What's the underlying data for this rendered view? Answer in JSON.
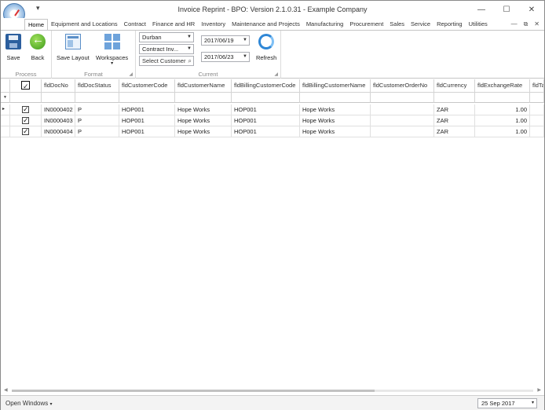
{
  "window": {
    "title": "Invoice Reprint - BPO: Version 2.1.0.31 - Example Company",
    "qat_symbol": "▾",
    "controls": {
      "minimize": "—",
      "maximize": "☐",
      "close": "✕"
    }
  },
  "ribbon_tabs": [
    "Home",
    "Equipment and Locations",
    "Contract",
    "Finance and HR",
    "Inventory",
    "Maintenance and Projects",
    "Manufacturing",
    "Procurement",
    "Sales",
    "Service",
    "Reporting",
    "Utilities"
  ],
  "tab_controls": {
    "minimize": "—",
    "restore": "⧉",
    "close": "✕"
  },
  "ribbon": {
    "process": {
      "label": "Process",
      "save": "Save",
      "back": "Back"
    },
    "format": {
      "label": "Format",
      "save_layout": "Save Layout",
      "workspaces": "Workspaces",
      "workspaces_arrow": "▾"
    },
    "current": {
      "label": "Current",
      "branch": "Durban",
      "doc_type": "Contract Inv...",
      "customer_placeholder": "Select Customer",
      "date_from": "2017/06/19",
      "date_to": "2017/06/23",
      "refresh": "Refresh"
    }
  },
  "grid": {
    "columns": [
      "fldDocNo",
      "fldDocStatus",
      "fldCustomerCode",
      "fldCustomerName",
      "fldBillingCustomerCode",
      "fldBillingCustomerName",
      "fldCustomerOrderNo",
      "fldCurrency",
      "fldExchangeRate",
      "fldTa"
    ],
    "filter_row_symbol": "▼",
    "current_row_symbol": "▸",
    "rows": [
      {
        "selected": true,
        "doc_no": "IN0000402",
        "status": "P",
        "cust_code": "HOP001",
        "cust_name": "Hope Works",
        "bill_code": "HOP001",
        "bill_name": "Hope Works",
        "order_no": "",
        "currency": "ZAR",
        "rate": "1.00"
      },
      {
        "selected": true,
        "doc_no": "IN0000403",
        "status": "P",
        "cust_code": "HOP001",
        "cust_name": "Hope Works",
        "bill_code": "HOP001",
        "bill_name": "Hope Works",
        "order_no": "",
        "currency": "ZAR",
        "rate": "1.00"
      },
      {
        "selected": true,
        "doc_no": "IN0000404",
        "status": "P",
        "cust_code": "HOP001",
        "cust_name": "Hope Works",
        "bill_code": "HOP001",
        "bill_name": "Hope Works",
        "order_no": "",
        "currency": "ZAR",
        "rate": "1.00"
      }
    ]
  },
  "status_bar": {
    "open_windows": "Open Windows",
    "open_windows_arrow": "▾",
    "date": "25 Sep 2017",
    "date_arrow": "▾"
  },
  "icons": [
    "app-logo-icon",
    "save-icon",
    "back-icon",
    "save-layout-icon",
    "workspaces-icon",
    "refresh-icon",
    "search-icon",
    "dropdown-arrow-icon",
    "filter-icon"
  ],
  "colors": {
    "accent": "#2f87d6",
    "tab_border": "#c5c5c5",
    "back_green": "#3d9a1a"
  }
}
